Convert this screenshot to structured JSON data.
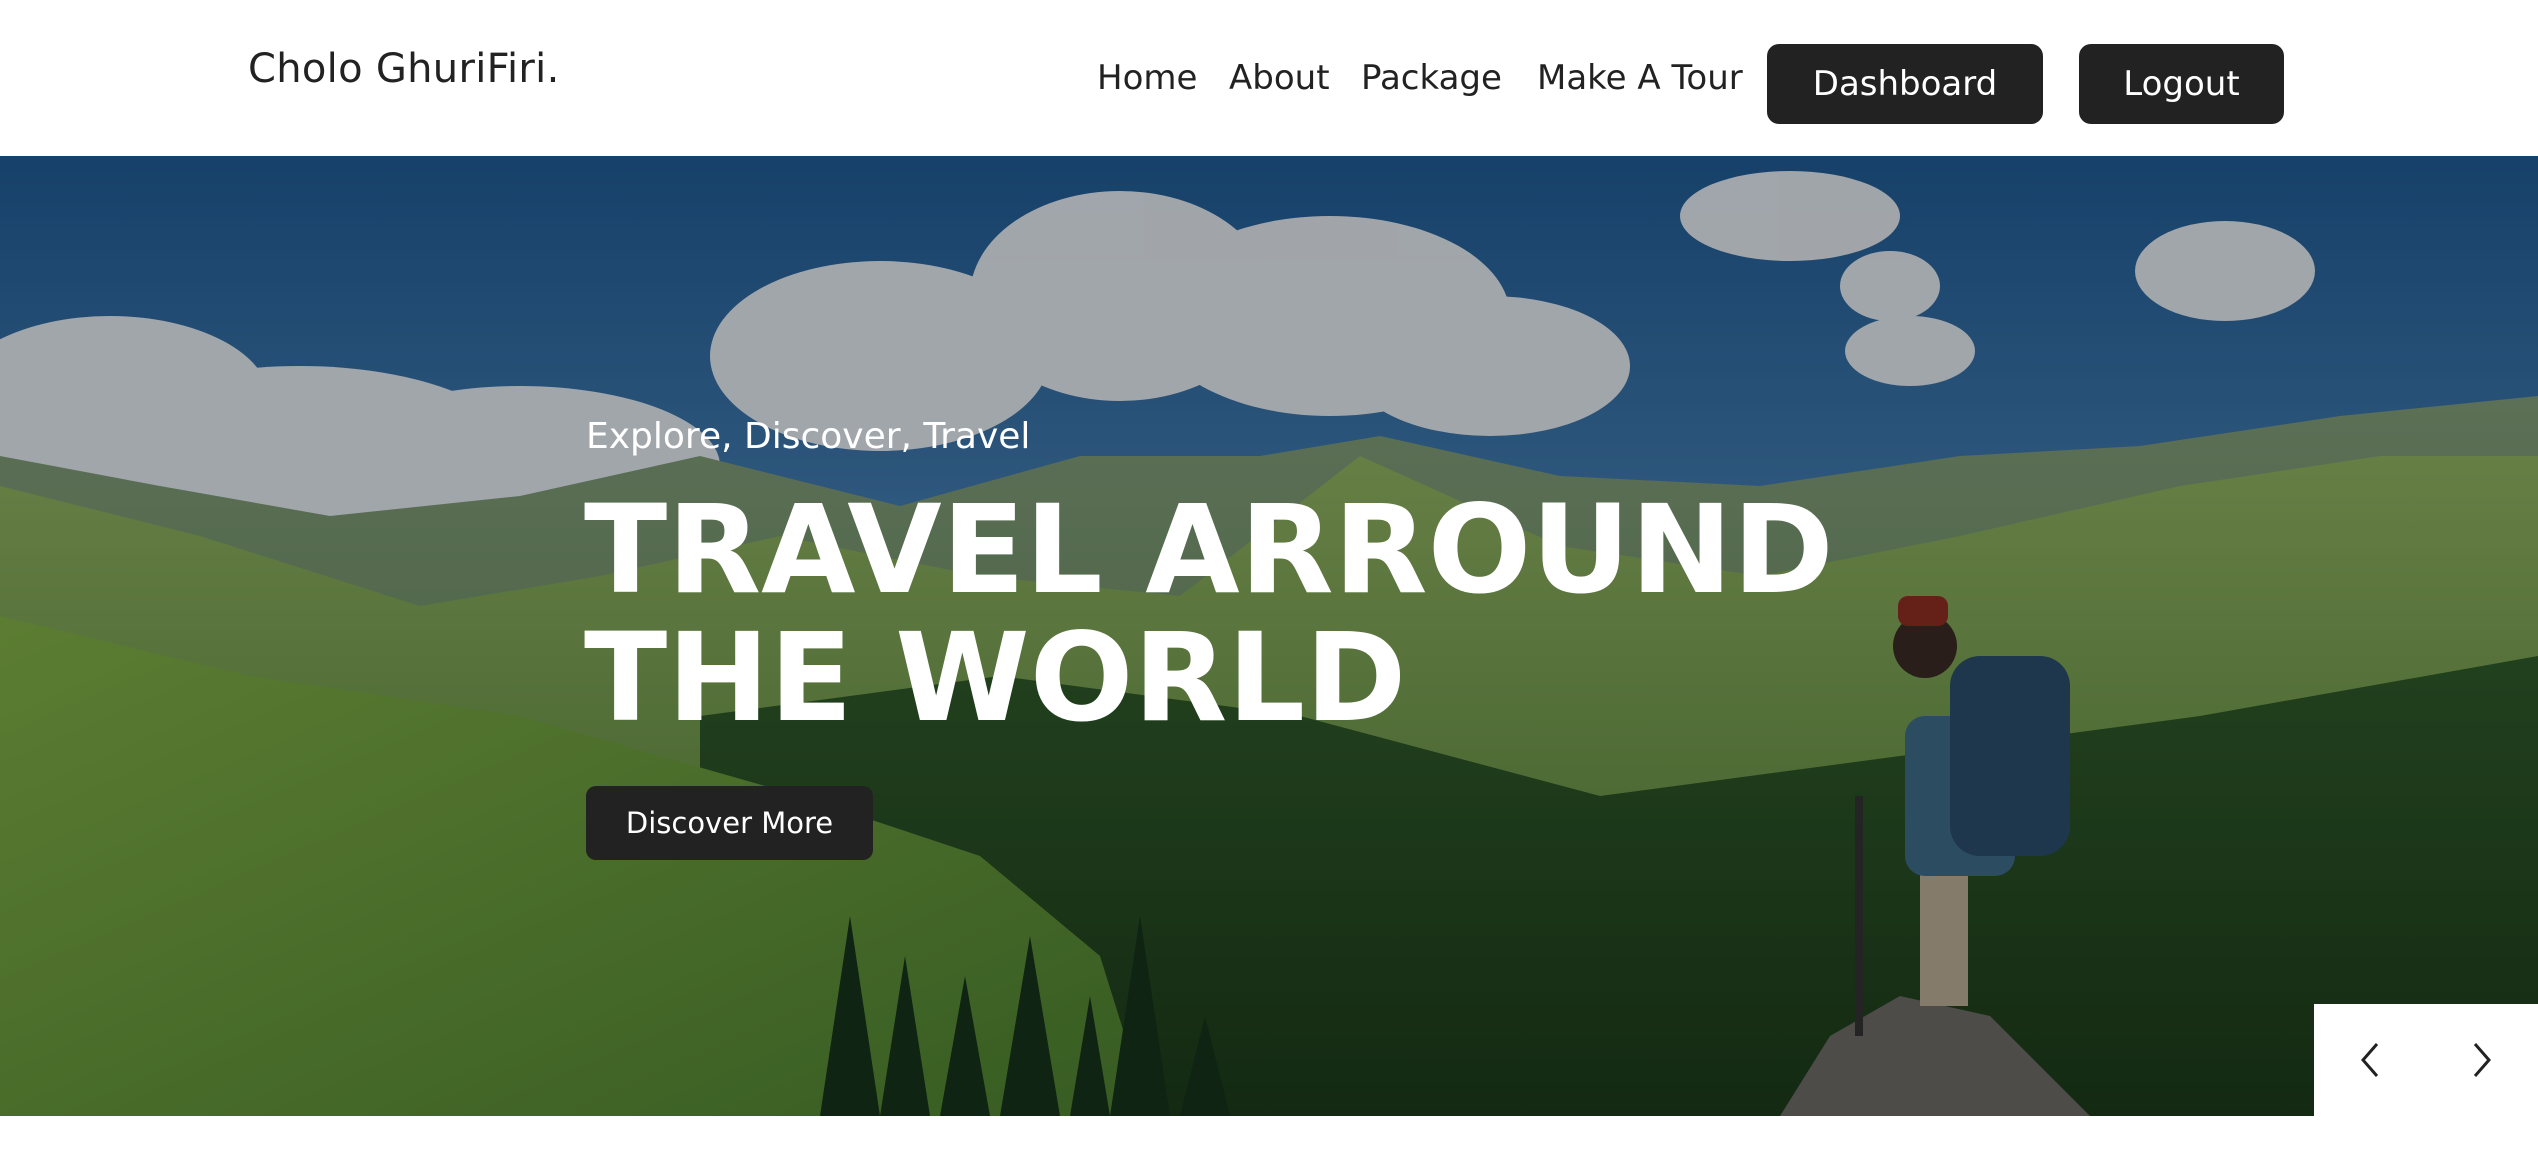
{
  "header": {
    "brand": "Cholo GhuriFiri.",
    "nav": {
      "home": "Home",
      "about": "About",
      "package": "Package",
      "make_a_tour": "Make A Tour"
    },
    "dashboard_label": "Dashboard",
    "logout_label": "Logout"
  },
  "hero": {
    "tagline": "Explore, Discover, Travel",
    "headline_line1": "TRAVEL ARROUND",
    "headline_line2": "THE WORLD",
    "cta_label": "Discover More",
    "background_image": "mountain-hiker-photo",
    "slider": {
      "prev_icon": "chevron-left-icon",
      "next_icon": "chevron-right-icon"
    }
  },
  "colors": {
    "button_bg": "#222222",
    "button_text": "#ffffff",
    "header_bg": "#ffffff",
    "sky": "#2f5f8f",
    "grass": "#6f9a45"
  }
}
